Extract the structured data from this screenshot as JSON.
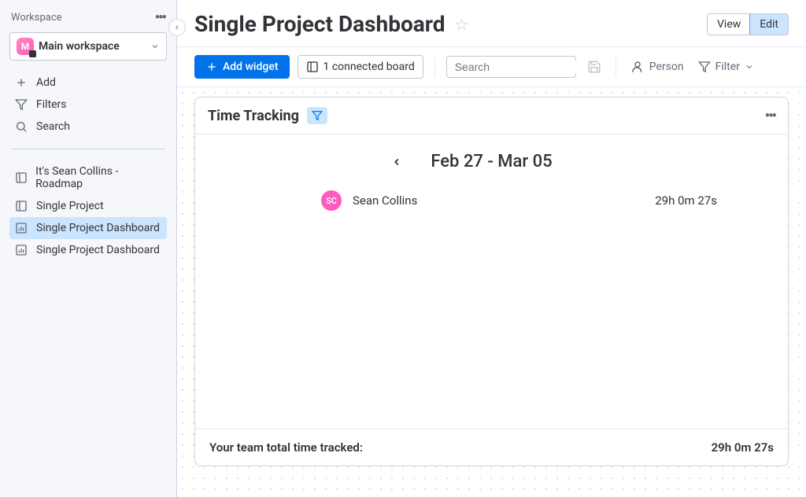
{
  "sidebar": {
    "header": "Workspace",
    "workspace": {
      "initial": "M",
      "name": "Main workspace"
    },
    "actions": {
      "add": "Add",
      "filters": "Filters",
      "search": "Search"
    },
    "boards": [
      {
        "label": "It's Sean Collins - Roadmap",
        "icon": "board",
        "active": false
      },
      {
        "label": "Single Project",
        "icon": "board",
        "active": false
      },
      {
        "label": "Single Project Dashboard",
        "icon": "dashboard",
        "active": true
      },
      {
        "label": "Single Project Dashboard",
        "icon": "dashboard",
        "active": false
      }
    ]
  },
  "header": {
    "title": "Single Project Dashboard",
    "view_label": "View",
    "edit_label": "Edit"
  },
  "toolbar": {
    "add_widget": "Add widget",
    "connected_board": "1 connected board",
    "search_placeholder": "Search",
    "person": "Person",
    "filter": "Filter"
  },
  "widget": {
    "title": "Time Tracking",
    "date_range": "Feb 27 - Mar 05",
    "member": {
      "initials": "SC",
      "name": "Sean Collins",
      "time": "29h 0m 27s"
    },
    "footer_label": "Your team total time tracked:",
    "footer_total": "29h 0m 27s"
  }
}
